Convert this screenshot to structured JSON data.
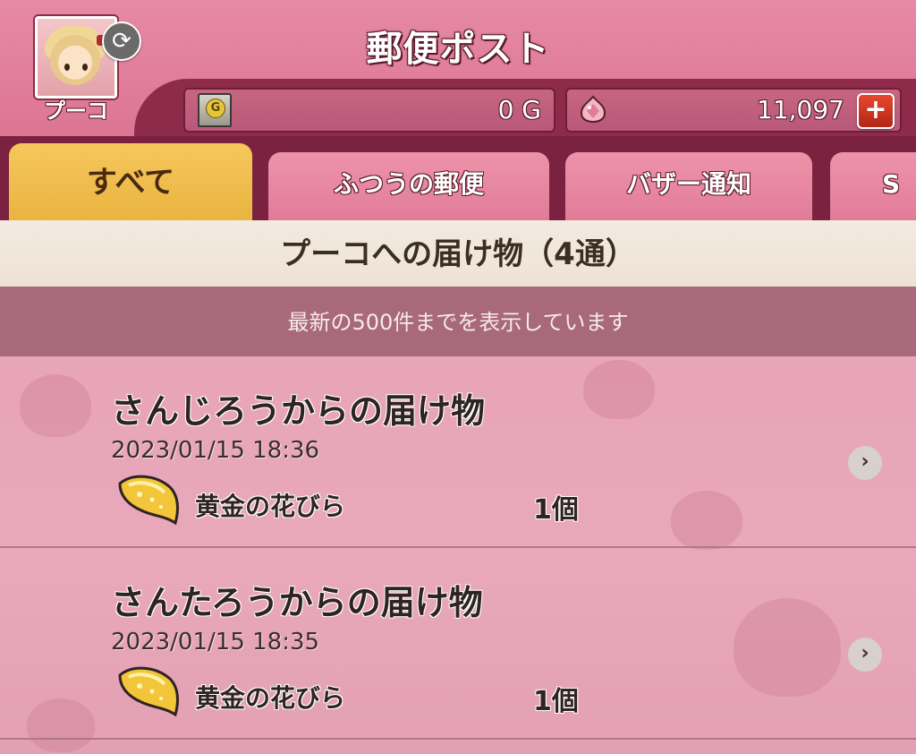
{
  "header": {
    "title": "郵便ポスト",
    "player_name": "プーコ",
    "refresh_icon": "refresh-icon",
    "gold": {
      "icon": "gold-bank-icon",
      "icon_letter": "G",
      "value": "0 G"
    },
    "gems": {
      "icon": "gem-icon",
      "value": "11,097",
      "add_label": "+"
    }
  },
  "tabs": [
    {
      "label": "すべて",
      "active": true
    },
    {
      "label": "ふつうの郵便",
      "active": false
    },
    {
      "label": "バザー通知",
      "active": false
    },
    {
      "label": "S",
      "active": false
    }
  ],
  "section": {
    "title": "プーコへの届け物（4通）",
    "notice": "最新の500件までを表示しています"
  },
  "mails": [
    {
      "sender": "さんじろうからの届け物",
      "date": "2023/01/15  18:36",
      "item_icon": "golden-petal-icon",
      "item_name": "黄金の花びら",
      "quantity": "1個",
      "chevron": "›"
    },
    {
      "sender": "さんたろうからの届け物",
      "date": "2023/01/15  18:35",
      "item_icon": "golden-petal-icon",
      "item_name": "黄金の花びら",
      "quantity": "1個",
      "chevron": "›"
    }
  ],
  "colors": {
    "header_pink": "#dc7594",
    "tab_bar": "#7a2240",
    "tab_active": "#f6c75c",
    "notice_bar": "#a7697b",
    "list_bg": "#e8a4b8"
  }
}
